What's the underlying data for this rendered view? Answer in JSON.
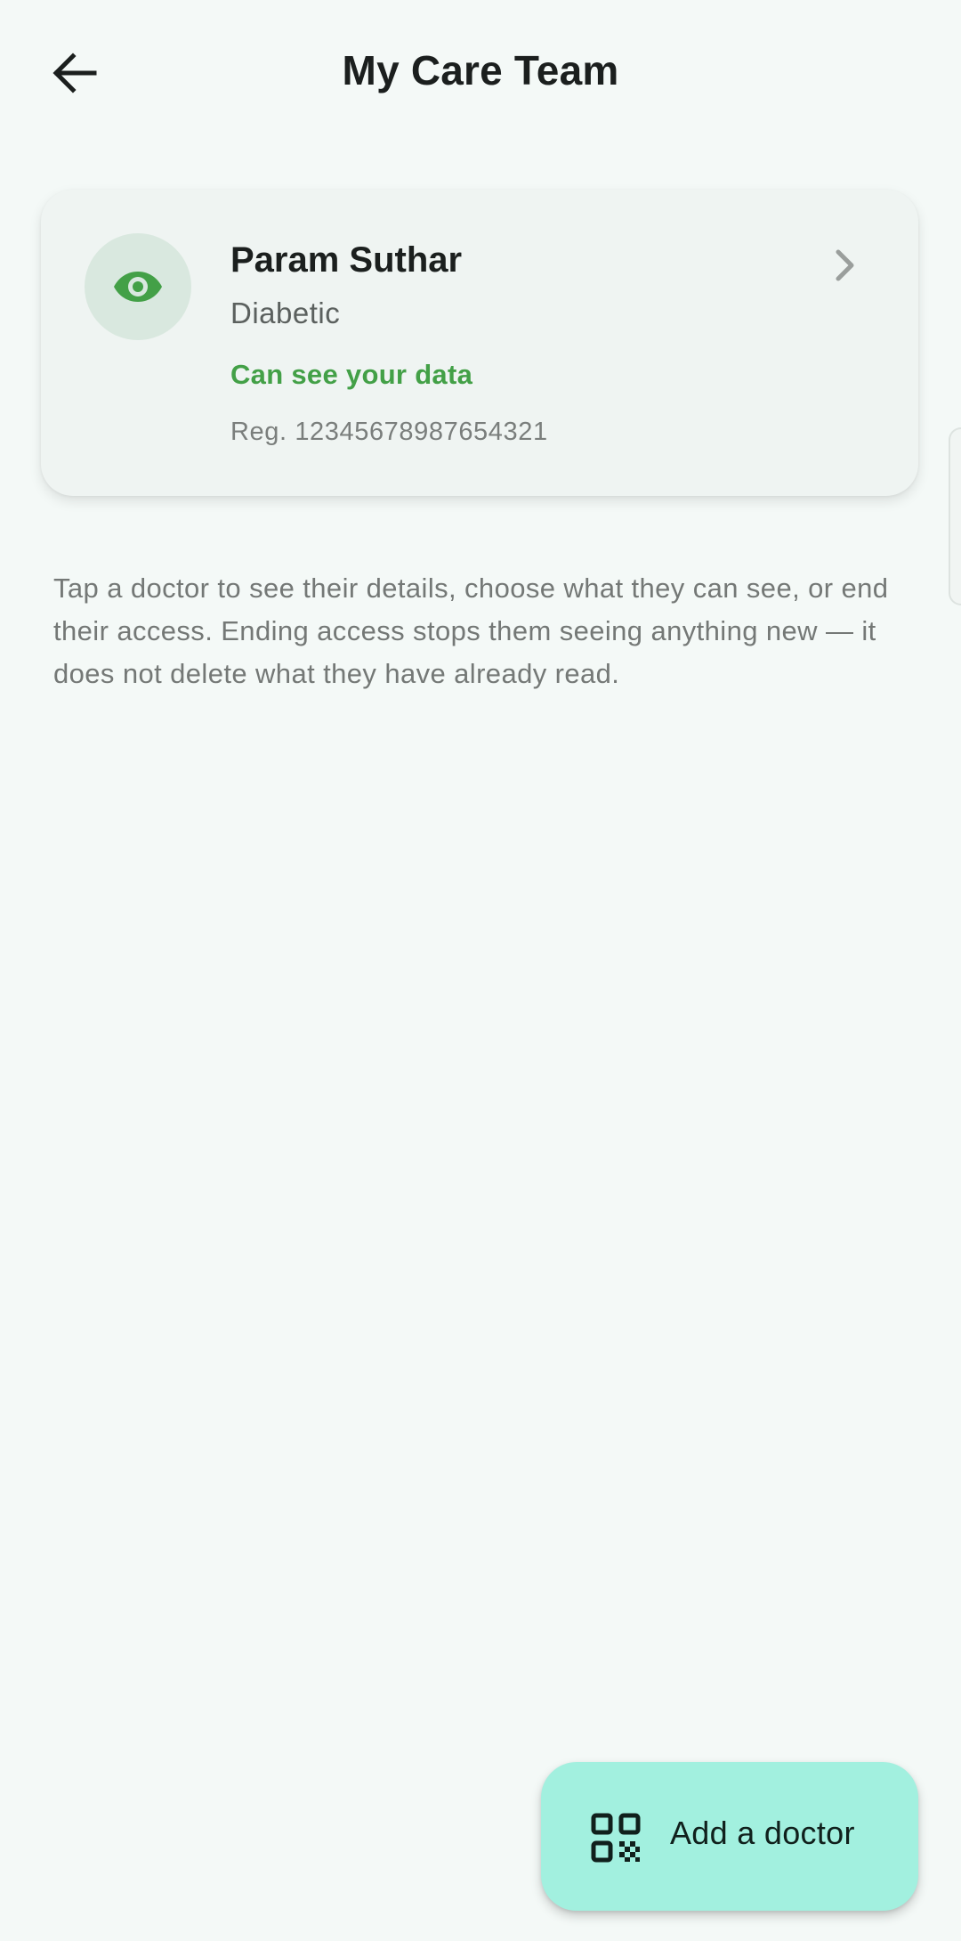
{
  "header": {
    "title": "My Care Team",
    "back_icon": "arrow-left-icon"
  },
  "care_team": [
    {
      "name": "Param Suthar",
      "specialty": "Diabetic",
      "access_status": "Can see your data",
      "registration": "Reg. 12345678987654321",
      "avatar_icon": "eye-icon",
      "trailing_icon": "chevron-right-icon"
    }
  ],
  "help_text": "Tap a doctor to see their details, choose what they can see, or end their access. Ending access stops them seeing anything new — it does not delete what they have already read.",
  "fab": {
    "label": "Add a doctor",
    "icon": "qr-code-icon"
  },
  "colors": {
    "background": "#f4f9f7",
    "card": "#eff4f2",
    "accent_green": "#43a047",
    "fab": "#a2f0df"
  }
}
